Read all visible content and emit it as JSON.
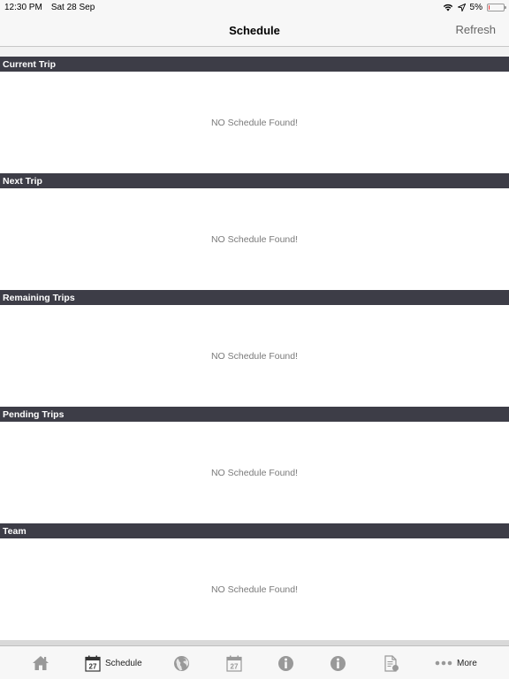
{
  "status_bar": {
    "time": "12:30 PM",
    "date": "Sat 28 Sep",
    "battery_percent": "5%",
    "battery_level": 0.05,
    "icons": [
      "wifi-icon",
      "location-arrow-icon",
      "battery-icon"
    ]
  },
  "nav": {
    "title": "Schedule",
    "refresh_label": "Refresh"
  },
  "sections": [
    {
      "title": "Current Trip",
      "empty_message": "NO Schedule Found!"
    },
    {
      "title": "Next Trip",
      "empty_message": "NO Schedule Found!"
    },
    {
      "title": "Remaining Trips",
      "empty_message": "NO Schedule Found!"
    },
    {
      "title": "Pending Trips",
      "empty_message": "NO Schedule Found!"
    },
    {
      "title": "Team",
      "empty_message": "NO Schedule Found!"
    }
  ],
  "tab_bar": {
    "items": [
      {
        "icon": "home-icon",
        "label": ""
      },
      {
        "icon": "calendar-icon",
        "label": "Schedule",
        "calendar_day": "27",
        "selected": true
      },
      {
        "icon": "globe-icon",
        "label": ""
      },
      {
        "icon": "calendar-icon",
        "label": "",
        "calendar_day": "27"
      },
      {
        "icon": "info-icon",
        "label": ""
      },
      {
        "icon": "info-icon",
        "label": ""
      },
      {
        "icon": "document-icon",
        "label": ""
      },
      {
        "icon": "more-dots-icon",
        "label": "More"
      }
    ]
  },
  "colors": {
    "section_header_bg": "#3d3d47",
    "section_header_text": "#ffffff",
    "empty_text": "#7a7a7a",
    "tab_icon_inactive": "#999999",
    "refresh_text": "#666666"
  }
}
